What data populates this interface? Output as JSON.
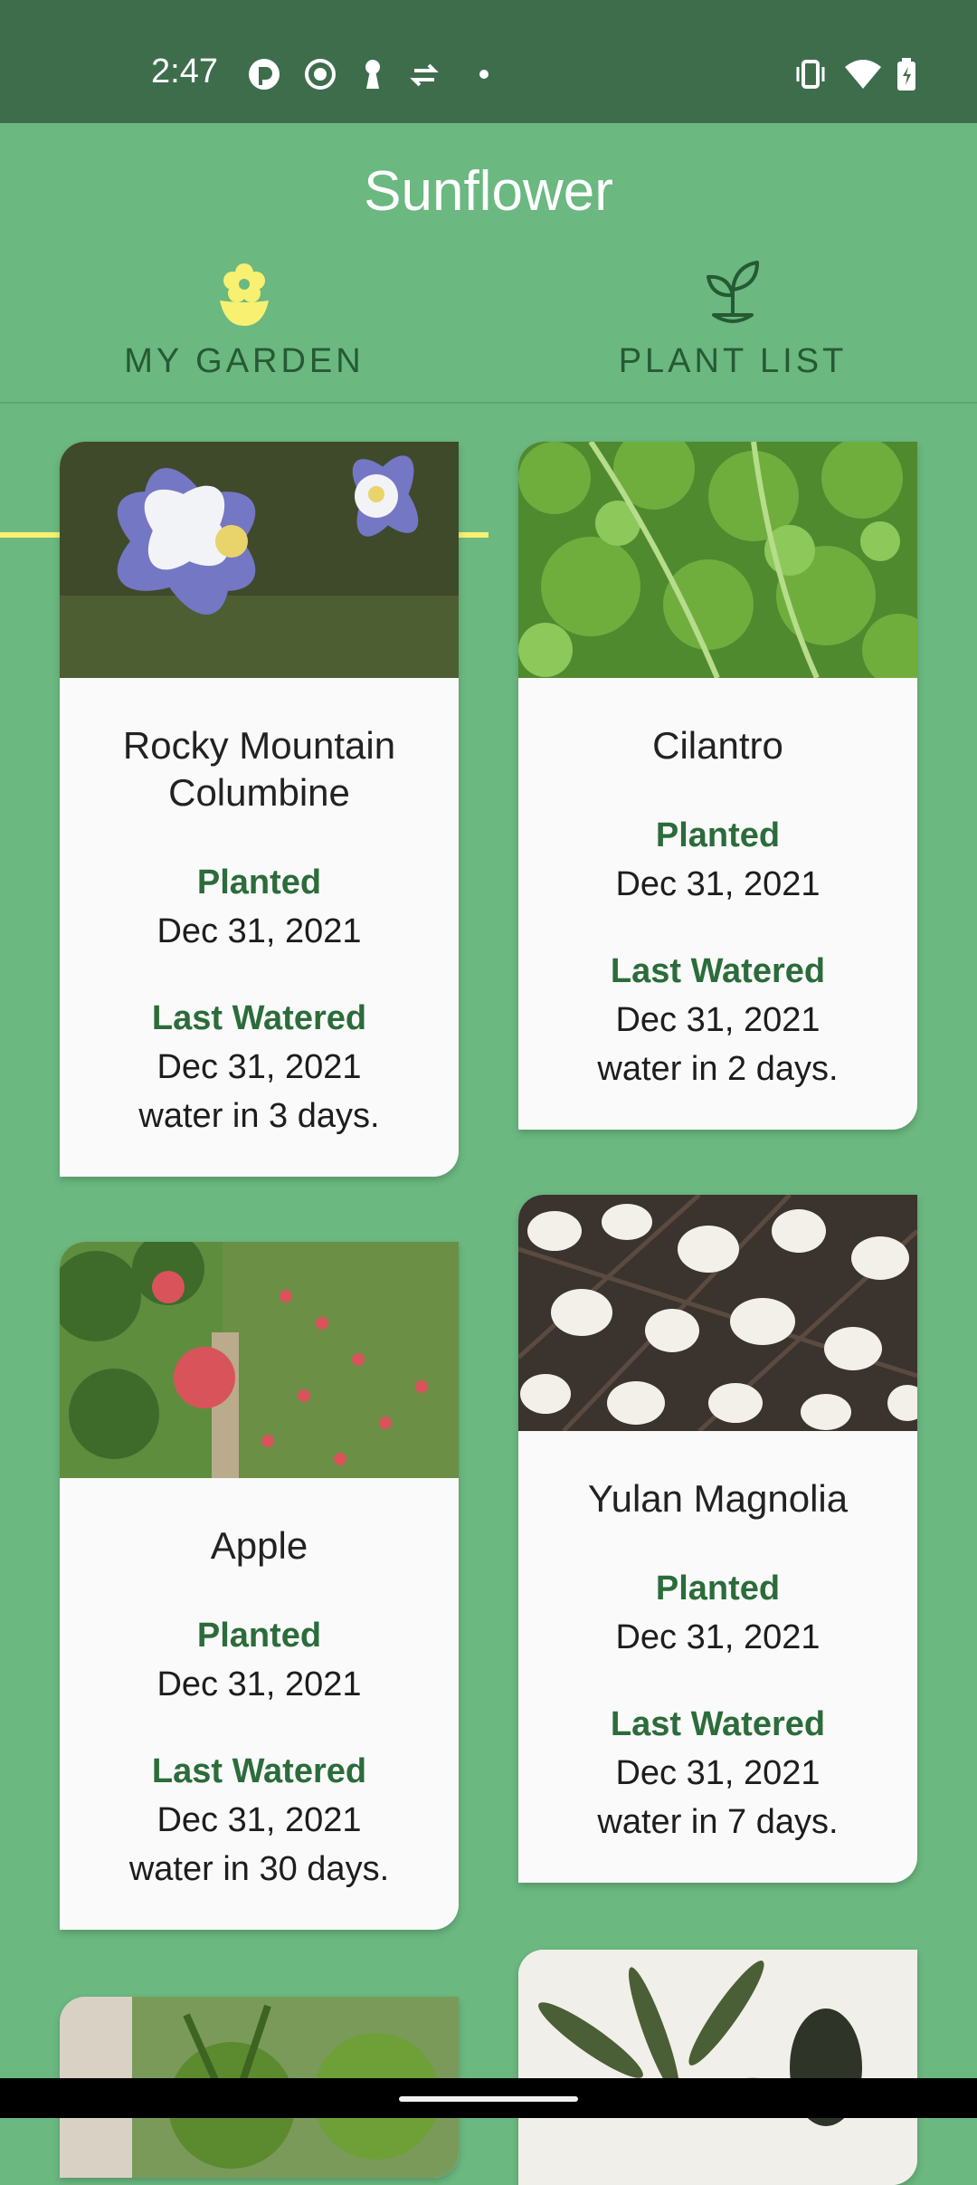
{
  "status_bar": {
    "time": "2:47",
    "icons_left": [
      "app-icon",
      "record-icon",
      "keyhole-icon",
      "transfer-icon",
      "dot-icon"
    ],
    "icons_right": [
      "vibrate-icon",
      "wifi-icon",
      "battery-charging-icon"
    ]
  },
  "app": {
    "title": "Sunflower",
    "tabs": [
      {
        "label": "MY GARDEN",
        "icon": "flower-icon",
        "selected": true
      },
      {
        "label": "PLANT LIST",
        "icon": "sprout-icon",
        "selected": false
      }
    ]
  },
  "plants": [
    {
      "name_line1": "Rocky Mountain",
      "name_line2": "Columbine",
      "planted_label": "Planted",
      "planted_date": "Dec 31, 2021",
      "watered_label": "Last Watered",
      "watered_date": "Dec 31, 2021",
      "water_in": "water in 3 days."
    },
    {
      "name": "Cilantro",
      "planted_label": "Planted",
      "planted_date": "Dec 31, 2021",
      "watered_label": "Last Watered",
      "watered_date": "Dec 31, 2021",
      "water_in": "water in 2 days."
    },
    {
      "name": "Apple",
      "planted_label": "Planted",
      "planted_date": "Dec 31, 2021",
      "watered_label": "Last Watered",
      "watered_date": "Dec 31, 2021",
      "water_in": "water in 30 days."
    },
    {
      "name": "Yulan Magnolia",
      "planted_label": "Planted",
      "planted_date": "Dec 31, 2021",
      "watered_label": "Last Watered",
      "watered_date": "Dec 31, 2021",
      "water_in": "water in 7 days."
    }
  ],
  "colors": {
    "background": "#6bb880",
    "status_bar": "#3e6d4c",
    "tab_indicator": "#f8f071",
    "tab_text": "#255a33",
    "label_green": "#2b6c3a"
  }
}
